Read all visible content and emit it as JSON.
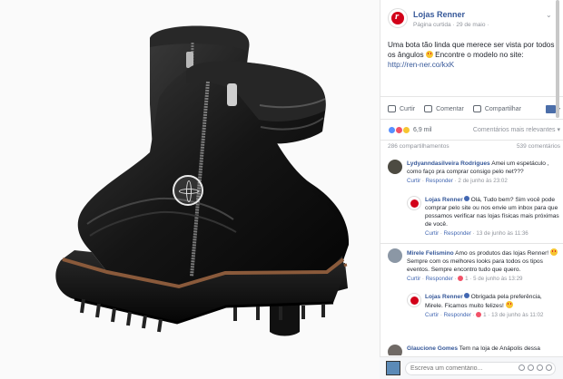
{
  "post": {
    "page_name": "Lojas Renner",
    "meta": "Página curtida · 29 de maio ·",
    "text": "Uma bota tão linda que merece ser vista por todos os ângulos",
    "text_cont": " Encontre o modelo no site:",
    "link": "http://ren-ner.co/kxK"
  },
  "actions": {
    "like": "Curtir",
    "comment": "Comentar",
    "share": "Compartilhar"
  },
  "reactions": {
    "count": "6,9 mil",
    "sort": "Comentários mais relevantes ▾"
  },
  "counts": {
    "shares": "286 compartilhamentos",
    "comments": "539 comentários"
  },
  "comments": [
    {
      "author": "Lydyanndasilveira Rodrigues",
      "text": "Amei um espetáculo , como faço pra comprar consigo pelo net???",
      "like": "Curtir",
      "reply": "Responder",
      "time": "2 de junho às 23:02"
    },
    {
      "author": "Lojas Renner",
      "text": "Olá, Tudo bem? Sim você pode comprar pelo site ou nos envie um inbox para que possamos verificar nas lojas físicas mais próximas de você.",
      "like": "Curtir",
      "reply": "Responder",
      "time": "13 de junho às 11:36"
    },
    {
      "author": "Mirele Felismino",
      "text": "Amo os produtos das lojas Renner!",
      "text2": "Sempre com os melhores looks para todos os tipos eventos. Sempre encontro tudo que quero.",
      "like": "Curtir",
      "reply": "Responder",
      "reply_count": "1",
      "time": "5 de junho às 13:29"
    },
    {
      "author": "Lojas Renner",
      "text": "Obrigada pela preferência, Mirele. Ficamos muito felizes!",
      "like": "Curtir",
      "reply": "Responder",
      "reply_count": "1",
      "time": "13 de junho às 11:02"
    },
    {
      "author": "Glaucione Gomes",
      "text": "Tem na loja de Anápolis dessa"
    }
  ],
  "composer": {
    "placeholder": "Escreva um comentário..."
  }
}
